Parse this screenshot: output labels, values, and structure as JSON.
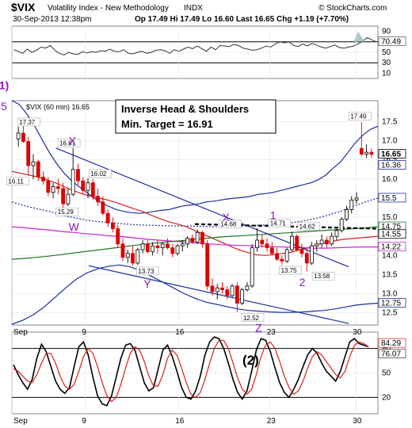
{
  "header": {
    "symbol": "$VIX",
    "name": "Volatility Index - New Methodology",
    "exchange": "INDX",
    "date_time": "30-Sep-2013 12:38pm",
    "quote": "Op 17.49  Hi 17.49  Lo 16.60  Last 16.65  Chg +1.19 (+7.70%)",
    "watermark": "© StockCharts.com"
  },
  "chart_data": [
    {
      "type": "line",
      "panel": "rsi",
      "y_ticks": [
        "90",
        "70",
        "50",
        "30",
        "10"
      ],
      "ylim": [
        0,
        100
      ],
      "guide_lines": [
        70,
        30
      ],
      "value_badge": "70.49",
      "series": [
        {
          "values": [
            55,
            52,
            48,
            56,
            50,
            54,
            60,
            58,
            63,
            54,
            48,
            45,
            50,
            47,
            46,
            51,
            49,
            51,
            50,
            53,
            52,
            56,
            52,
            51,
            55,
            48,
            47,
            50,
            52,
            48,
            50,
            54,
            55,
            53,
            48,
            55,
            52,
            56,
            60,
            57,
            62,
            57,
            52,
            60,
            55,
            63,
            62,
            61,
            65,
            63,
            58,
            56,
            54,
            55,
            58,
            62,
            60,
            66,
            70,
            68,
            70,
            63,
            61,
            66,
            62,
            67,
            64,
            60,
            58,
            61,
            64,
            59,
            58,
            60,
            62,
            66,
            71,
            78,
            74,
            70
          ]
        }
      ]
    },
    {
      "type": "candlestick",
      "panel": "price",
      "title": "$VIX (60 min) 16.65",
      "y_ticks": [
        "17.5",
        "17.0",
        "16.5",
        "16.0",
        "15.5",
        "15.0",
        "14.5",
        "14.0",
        "13.5",
        "13.0",
        "12.5"
      ],
      "ylim": [
        12.18,
        18.05
      ],
      "x_tick_labels": [
        "Sep",
        "9",
        "16",
        "23",
        "30"
      ],
      "bars": [
        [
          17.05,
          17.37,
          16.85,
          17.2
        ],
        [
          17.2,
          17.42,
          16.95,
          16.98
        ],
        [
          16.98,
          17.1,
          16.1,
          16.35
        ],
        [
          16.35,
          16.65,
          16.0,
          16.45
        ],
        [
          16.45,
          16.5,
          15.95,
          16.05
        ],
        [
          16.05,
          16.2,
          15.85,
          15.95
        ],
        [
          15.95,
          16.05,
          15.55,
          15.65
        ],
        [
          15.65,
          15.9,
          15.5,
          15.8
        ],
        [
          15.8,
          16.0,
          15.6,
          15.75
        ],
        [
          15.75,
          15.9,
          15.25,
          15.35
        ],
        [
          15.35,
          15.75,
          15.29,
          15.6
        ],
        [
          15.6,
          16.81,
          15.55,
          16.25
        ],
        [
          16.25,
          16.4,
          15.85,
          15.95
        ],
        [
          15.95,
          16.05,
          15.6,
          15.7
        ],
        [
          15.7,
          16.02,
          15.5,
          15.9
        ],
        [
          15.9,
          16.0,
          15.45,
          15.55
        ],
        [
          15.55,
          15.75,
          15.3,
          15.4
        ],
        [
          15.4,
          15.55,
          15.05,
          15.1
        ],
        [
          15.1,
          15.2,
          14.75,
          14.85
        ],
        [
          14.85,
          15.0,
          14.6,
          14.7
        ],
        [
          14.7,
          14.8,
          14.2,
          14.3
        ],
        [
          14.3,
          14.45,
          13.85,
          13.95
        ],
        [
          13.95,
          14.15,
          13.8,
          14.05
        ],
        [
          14.05,
          14.25,
          13.73,
          13.8
        ],
        [
          13.8,
          14.2,
          13.75,
          14.15
        ],
        [
          14.15,
          14.4,
          14.05,
          14.3
        ],
        [
          14.3,
          14.4,
          14.05,
          14.1
        ],
        [
          14.1,
          14.35,
          14.0,
          14.25
        ],
        [
          14.25,
          14.4,
          14.05,
          14.2
        ],
        [
          14.2,
          14.35,
          14.0,
          14.3
        ],
        [
          14.3,
          14.45,
          14.15,
          14.2
        ],
        [
          14.2,
          14.3,
          13.95,
          14.05
        ],
        [
          14.05,
          14.3,
          14.0,
          14.25
        ],
        [
          14.25,
          14.4,
          14.1,
          14.3
        ],
        [
          14.3,
          14.5,
          14.2,
          14.45
        ],
        [
          14.45,
          14.55,
          14.3,
          14.35
        ],
        [
          14.35,
          14.68,
          14.3,
          14.6
        ],
        [
          14.6,
          14.65,
          14.2,
          14.3
        ],
        [
          14.3,
          14.4,
          13.1,
          13.2
        ],
        [
          13.2,
          13.4,
          12.95,
          13.05
        ],
        [
          13.05,
          13.25,
          12.85,
          13.15
        ],
        [
          13.15,
          13.3,
          13.0,
          13.1
        ],
        [
          13.1,
          13.2,
          12.85,
          12.95
        ],
        [
          12.95,
          13.25,
          12.9,
          13.2
        ],
        [
          13.2,
          13.3,
          12.52,
          12.75
        ],
        [
          12.75,
          13.15,
          12.7,
          13.1
        ],
        [
          13.1,
          13.3,
          13.05,
          13.2
        ],
        [
          13.2,
          14.3,
          13.15,
          14.2
        ],
        [
          14.2,
          14.71,
          14.1,
          14.4
        ],
        [
          14.4,
          14.55,
          14.2,
          14.3
        ],
        [
          14.3,
          14.45,
          14.1,
          14.2
        ],
        [
          14.2,
          14.35,
          14.0,
          14.05
        ],
        [
          14.05,
          14.2,
          13.85,
          13.9
        ],
        [
          13.9,
          14.0,
          13.75,
          13.85
        ],
        [
          13.85,
          14.2,
          13.8,
          14.15
        ],
        [
          14.15,
          14.62,
          14.1,
          14.5
        ],
        [
          14.5,
          14.55,
          14.1,
          14.15
        ],
        [
          14.15,
          14.3,
          13.95,
          14.05
        ],
        [
          14.05,
          14.2,
          13.58,
          13.8
        ],
        [
          13.8,
          14.35,
          13.75,
          14.25
        ],
        [
          14.25,
          14.4,
          14.1,
          14.3
        ],
        [
          14.3,
          14.55,
          14.2,
          14.4
        ],
        [
          14.4,
          14.5,
          14.2,
          14.3
        ],
        [
          14.3,
          14.6,
          14.25,
          14.5
        ],
        [
          14.5,
          14.7,
          14.4,
          14.65
        ],
        [
          14.65,
          15.0,
          14.6,
          14.95
        ],
        [
          14.95,
          15.3,
          14.9,
          15.2
        ],
        [
          15.2,
          15.55,
          15.1,
          15.45
        ],
        [
          15.45,
          15.65,
          15.35,
          15.5
        ],
        [
          16.8,
          17.49,
          16.6,
          16.65
        ],
        [
          16.65,
          16.9,
          16.55,
          16.7
        ],
        [
          16.7,
          16.8,
          16.55,
          16.65
        ]
      ],
      "moving_averages": [
        {
          "color": "#d62020",
          "values": [
            16.2,
            16.15,
            16.1,
            16.05,
            15.98,
            15.9,
            15.8,
            15.7,
            15.62,
            15.55,
            15.5,
            15.45,
            15.38,
            15.3,
            15.22,
            15.15,
            15.05,
            14.96,
            14.88,
            14.82,
            14.75,
            14.65,
            14.55,
            14.45,
            14.35,
            14.25,
            14.15,
            14.08,
            14.02,
            14.0,
            14.02,
            14.05,
            14.08,
            14.15,
            14.2,
            14.28,
            14.34,
            14.38,
            14.42,
            14.44,
            14.46,
            14.48,
            14.5
          ]
        },
        {
          "color": "#cc22cc",
          "values": [
            14.75,
            14.73,
            14.7,
            14.68,
            14.65,
            14.62,
            14.6,
            14.57,
            14.55,
            14.52,
            14.5,
            14.48,
            14.45,
            14.42,
            14.4,
            14.38,
            14.36,
            14.34,
            14.32,
            14.3,
            14.28,
            14.27,
            14.26,
            14.25,
            14.24,
            14.23,
            14.22,
            14.21,
            14.2,
            14.19,
            14.19,
            14.2,
            14.21,
            14.22,
            14.22,
            14.22
          ]
        },
        {
          "color": "#227722",
          "values": [
            13.9,
            13.92,
            13.95,
            13.98,
            14.02,
            14.06,
            14.1,
            14.14,
            14.18,
            14.22,
            14.26,
            14.3,
            14.33,
            14.36,
            14.39,
            14.42,
            14.45,
            14.48,
            14.5,
            14.52,
            14.54,
            14.56,
            14.58,
            14.6,
            14.62,
            14.64,
            14.66,
            14.68,
            14.7,
            14.72,
            14.75
          ]
        }
      ],
      "bollinger": {
        "color": "#1c2fa0",
        "upper": [
          18.05,
          17.95,
          17.7,
          17.4,
          17.05,
          16.7,
          16.4,
          16.15,
          15.95,
          15.8,
          15.65,
          15.5,
          15.38,
          15.28,
          15.2,
          15.15,
          15.12,
          15.1,
          15.12,
          15.15,
          15.18,
          15.2,
          15.25,
          15.3,
          15.32,
          15.35,
          15.4,
          15.42,
          15.45,
          15.48,
          15.5,
          15.52,
          15.55,
          15.6,
          15.62,
          15.65,
          15.7,
          15.75,
          15.8,
          15.85,
          15.9,
          15.98,
          16.1,
          16.28,
          16.45,
          16.7,
          16.95,
          17.15,
          17.3,
          17.38
        ],
        "lower": [
          12.2,
          12.3,
          12.45,
          12.65,
          12.9,
          13.15,
          13.38,
          13.55,
          13.65,
          13.72,
          13.75,
          13.7,
          13.6,
          13.45,
          13.3,
          13.15,
          13.0,
          12.88,
          12.78,
          12.72,
          12.66,
          12.6,
          12.56,
          12.54,
          12.52,
          12.51,
          12.51,
          12.52,
          12.54,
          12.56,
          12.6,
          12.65,
          12.7,
          12.73,
          12.75
        ],
        "middle": [
          15.4,
          15.3,
          15.22,
          15.15,
          15.05,
          14.98,
          14.92,
          14.88,
          14.85,
          14.82,
          14.8,
          14.79,
          14.78,
          14.77,
          14.77,
          14.76,
          14.75,
          14.76,
          14.77,
          14.78,
          14.8,
          14.82,
          14.85,
          14.9,
          14.96,
          15.05,
          15.15,
          15.28,
          15.4,
          15.5
        ]
      },
      "trendlines": [
        {
          "from": [
            16.81,
            0.12
          ],
          "to": [
            13.7,
            0.92
          ],
          "color": "#1c2fa0"
        },
        {
          "from": [
            13.73,
            0.21
          ],
          "to": [
            12.22,
            0.92
          ],
          "color": "#1c2fa0"
        }
      ],
      "neckline": {
        "from": [
          14.82,
          0.5
        ],
        "to": [
          14.7,
          0.995
        ],
        "style": "dashed"
      },
      "value_badges": [
        {
          "text": "16.65",
          "value": 16.65,
          "color": "#000",
          "bold": true
        },
        {
          "text": "16.36",
          "value": 16.36,
          "color": "#1c2fa0"
        },
        {
          "text": "15.5",
          "value": 15.5,
          "color": "#1c2fa0"
        },
        {
          "text": "14.75",
          "value": 14.75,
          "color": "#227722"
        },
        {
          "text": "14.55",
          "value": 14.55,
          "color": "#000"
        },
        {
          "text": "14.22",
          "value": 14.22,
          "color": "#cc22cc"
        },
        {
          "text": "12.75",
          "value": 12.75,
          "color": "#1c2fa0"
        }
      ],
      "price_labels": [
        {
          "text": "17.37",
          "value": 17.45
        },
        {
          "text": "16.81",
          "value": 16.9
        },
        {
          "text": "16.11",
          "value": 15.9
        },
        {
          "text": "16.02",
          "value": 16.1
        },
        {
          "text": "15.29",
          "value": 15.1
        },
        {
          "text": "13.73",
          "value": 13.55
        },
        {
          "text": "14.68",
          "value": 14.78
        },
        {
          "text": "14.71",
          "value": 14.8
        },
        {
          "text": "14.62",
          "value": 14.72
        },
        {
          "text": "13.75",
          "value": 13.57
        },
        {
          "text": "13.58",
          "value": 13.42
        },
        {
          "text": "12.52",
          "value": 12.33
        },
        {
          "text": "17.49",
          "value": 17.6
        }
      ],
      "wave_labels": [
        "X",
        "W",
        "Y",
        "X",
        "1",
        "2",
        "Z",
        "5",
        "1)"
      ],
      "annotation": {
        "line1": "Inverse Head & Shoulders",
        "line2": "Min. Target = 16.91"
      }
    },
    {
      "type": "line",
      "panel": "stochastic",
      "y_ticks": [
        "80",
        "50",
        "20"
      ],
      "ylim": [
        0,
        100
      ],
      "guide_lines": [
        80,
        20
      ],
      "value_badges": [
        "84.29",
        "76.07"
      ],
      "wave_label": "(2)",
      "x_tick_labels": [
        "Sep",
        "9",
        "16",
        "23",
        "30"
      ],
      "series": [
        {
          "color": "#000",
          "values": [
            60,
            48,
            38,
            30,
            42,
            68,
            85,
            76,
            58,
            40,
            30,
            25,
            32,
            58,
            82,
            88,
            72,
            45,
            22,
            12,
            10,
            22,
            45,
            68,
            84,
            86,
            78,
            58,
            38,
            28,
            32,
            55,
            78,
            84,
            70,
            52,
            32,
            20,
            18,
            28,
            46,
            72,
            88,
            94,
            92,
            80,
            62,
            42,
            26,
            18,
            28,
            52,
            78,
            92,
            90,
            76,
            56,
            38,
            26,
            20,
            30,
            42,
            58,
            72,
            80,
            74,
            62,
            52,
            46,
            40,
            52,
            70,
            88,
            92,
            86,
            84,
            82
          ]
        },
        {
          "color": "#d62020",
          "values": [
            55,
            52,
            46,
            40,
            38,
            48,
            62,
            74,
            74,
            62,
            46,
            34,
            30,
            36,
            52,
            70,
            80,
            74,
            58,
            38,
            22,
            15,
            20,
            36,
            56,
            74,
            82,
            78,
            64,
            46,
            34,
            34,
            48,
            68,
            78,
            72,
            56,
            38,
            24,
            20,
            26,
            42,
            62,
            80,
            90,
            90,
            80,
            62,
            44,
            30,
            24,
            30,
            48,
            70,
            84,
            88,
            80,
            64,
            46,
            32,
            24,
            28,
            40,
            56,
            70,
            76,
            72,
            64,
            56,
            48,
            44,
            52,
            70,
            84,
            88,
            86,
            82
          ]
        }
      ]
    }
  ]
}
